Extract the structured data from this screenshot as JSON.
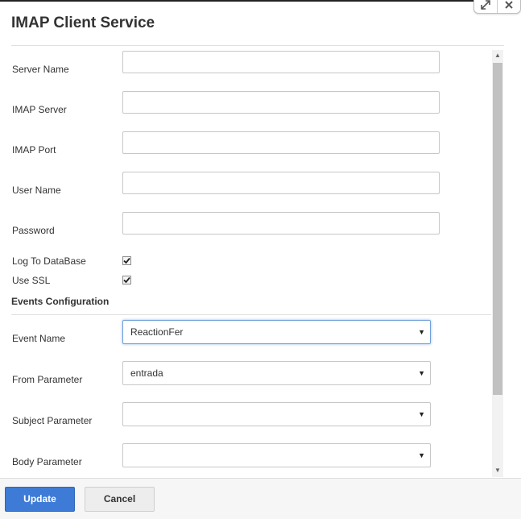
{
  "window": {
    "title": "IMAP Client Service",
    "controls": [
      {
        "icon": "expand-icon"
      },
      {
        "icon": "close-icon"
      }
    ]
  },
  "form": {
    "server_name": {
      "label": "Server Name",
      "value": ""
    },
    "imap_server": {
      "label": "IMAP Server",
      "value": ""
    },
    "imap_port": {
      "label": "IMAP Port",
      "value": ""
    },
    "user_name": {
      "label": "User Name",
      "value": ""
    },
    "password": {
      "label": "Password",
      "value": ""
    },
    "log_to_database": {
      "label": "Log To DataBase",
      "checked": true
    },
    "use_ssl": {
      "label": "Use SSL",
      "checked": true
    }
  },
  "events": {
    "section_title": "Events Configuration",
    "event_name": {
      "label": "Event Name",
      "value": "ReactionFer"
    },
    "from_parameter": {
      "label": "From Parameter",
      "value": "entrada"
    },
    "subject_parameter": {
      "label": "Subject Parameter",
      "value": ""
    },
    "body_parameter": {
      "label": "Body Parameter",
      "value": ""
    }
  },
  "footer": {
    "update_label": "Update",
    "cancel_label": "Cancel"
  },
  "colors": {
    "primary_button": "#3d7bd6",
    "focus_border": "#6fa0dc"
  }
}
